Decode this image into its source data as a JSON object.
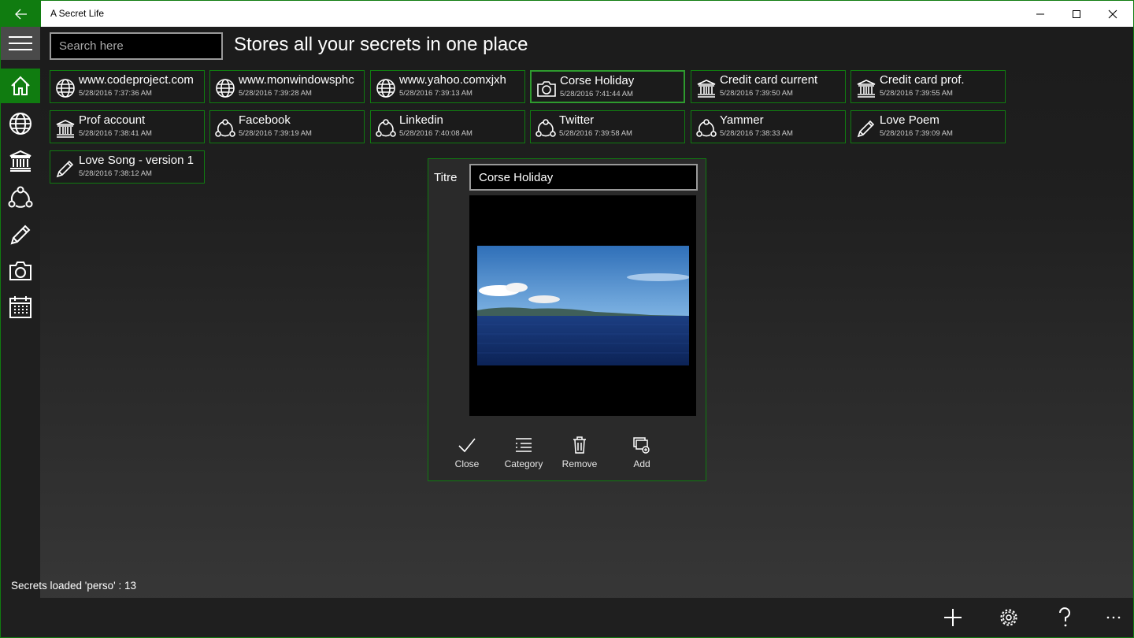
{
  "window": {
    "title": "A Secret Life",
    "accent": "#107c10",
    "controls": [
      "minimize-icon",
      "maximize-icon",
      "close-icon"
    ]
  },
  "search": {
    "placeholder": "Search here",
    "value": ""
  },
  "headline": "Stores all your secrets in one place",
  "rail": {
    "items": [
      "home-icon",
      "globe-icon",
      "bank-icon",
      "share-icon",
      "pencil-icon",
      "camera-icon",
      "calendar-icon"
    ],
    "active": "home-icon"
  },
  "tiles": [
    {
      "title": "www.codeproject.com",
      "date": "5/28/2016 7:37:36 AM",
      "icon": "globe-icon"
    },
    {
      "title": "www.monwindowsphc",
      "date": "5/28/2016 7:39:28 AM",
      "icon": "globe-icon"
    },
    {
      "title": "www.yahoo.comxjxh",
      "date": "5/28/2016 7:39:13 AM",
      "icon": "globe-icon"
    },
    {
      "title": "Corse Holiday",
      "date": "5/28/2016 7:41:44 AM",
      "icon": "camera-icon",
      "selected": true
    },
    {
      "title": "Credit card current",
      "date": "5/28/2016 7:39:50 AM",
      "icon": "bank-icon"
    },
    {
      "title": "Credit card prof.",
      "date": "5/28/2016 7:39:55 AM",
      "icon": "bank-icon"
    },
    {
      "title": "Prof account",
      "date": "5/28/2016 7:38:41 AM",
      "icon": "bank-icon"
    },
    {
      "title": "Facebook",
      "date": "5/28/2016 7:39:19 AM",
      "icon": "share-icon"
    },
    {
      "title": "Linkedin",
      "date": "5/28/2016 7:40:08 AM",
      "icon": "share-icon"
    },
    {
      "title": "Twitter",
      "date": "5/28/2016 7:39:58 AM",
      "icon": "share-icon"
    },
    {
      "title": "Yammer",
      "date": "5/28/2016 7:38:33 AM",
      "icon": "share-icon"
    },
    {
      "title": "Love Poem",
      "date": "5/28/2016 7:39:09 AM",
      "icon": "pencil-icon"
    },
    {
      "title": "Love Song - version 1",
      "date": "5/28/2016 7:38:12 AM",
      "icon": "pencil-icon"
    }
  ],
  "detail": {
    "label": "Titre",
    "title_value": "Corse Holiday",
    "actions": [
      {
        "label": "Close",
        "icon": "check-icon"
      },
      {
        "label": "Category",
        "icon": "category-icon"
      },
      {
        "label": "Remove",
        "icon": "trash-icon"
      },
      {
        "label": "Add",
        "icon": "add-image-icon"
      }
    ]
  },
  "status": "Secrets loaded 'perso' : 13",
  "commandbar": [
    "add-icon",
    "settings-icon",
    "help-icon",
    "more-icon"
  ]
}
